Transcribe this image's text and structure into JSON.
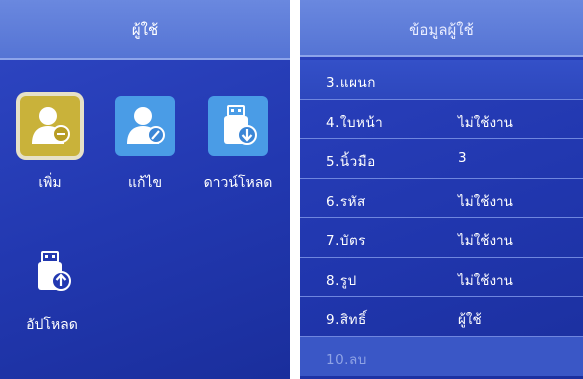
{
  "left_screen": {
    "title": "ผู้ใช้",
    "menu": [
      {
        "label": "เพิ่ม",
        "icon": "add-user-icon",
        "selected": true
      },
      {
        "label": "แก้ไข",
        "icon": "edit-user-icon",
        "selected": false
      },
      {
        "label": "ดาวน์โหลด",
        "icon": "usb-download-icon",
        "selected": false
      },
      {
        "label": "อัปโหลด",
        "icon": "usb-upload-icon",
        "selected": false
      }
    ]
  },
  "right_screen": {
    "title": "ข้อมูลผู้ใช้",
    "rows": [
      {
        "label": "3.แผนก",
        "value": ""
      },
      {
        "label": "4.ใบหน้า",
        "value": "ไม่ใช้งาน"
      },
      {
        "label": "5.นิ้วมือ",
        "value": "3"
      },
      {
        "label": "6.รหัส",
        "value": "ไม่ใช้งาน"
      },
      {
        "label": "7.บัตร",
        "value": "ไม่ใช้งาน"
      },
      {
        "label": "8.รูป",
        "value": "ไม่ใช้งาน"
      },
      {
        "label": "9.สิทธิ์",
        "value": "ผู้ใช้"
      },
      {
        "label": "10.ลบ",
        "value": ""
      }
    ]
  },
  "colors": {
    "screen_blue": "#2238b0",
    "titlebar": "#5574d4",
    "selected_tile": "#c9b23a",
    "icon_tile": "#4a9ce6"
  }
}
